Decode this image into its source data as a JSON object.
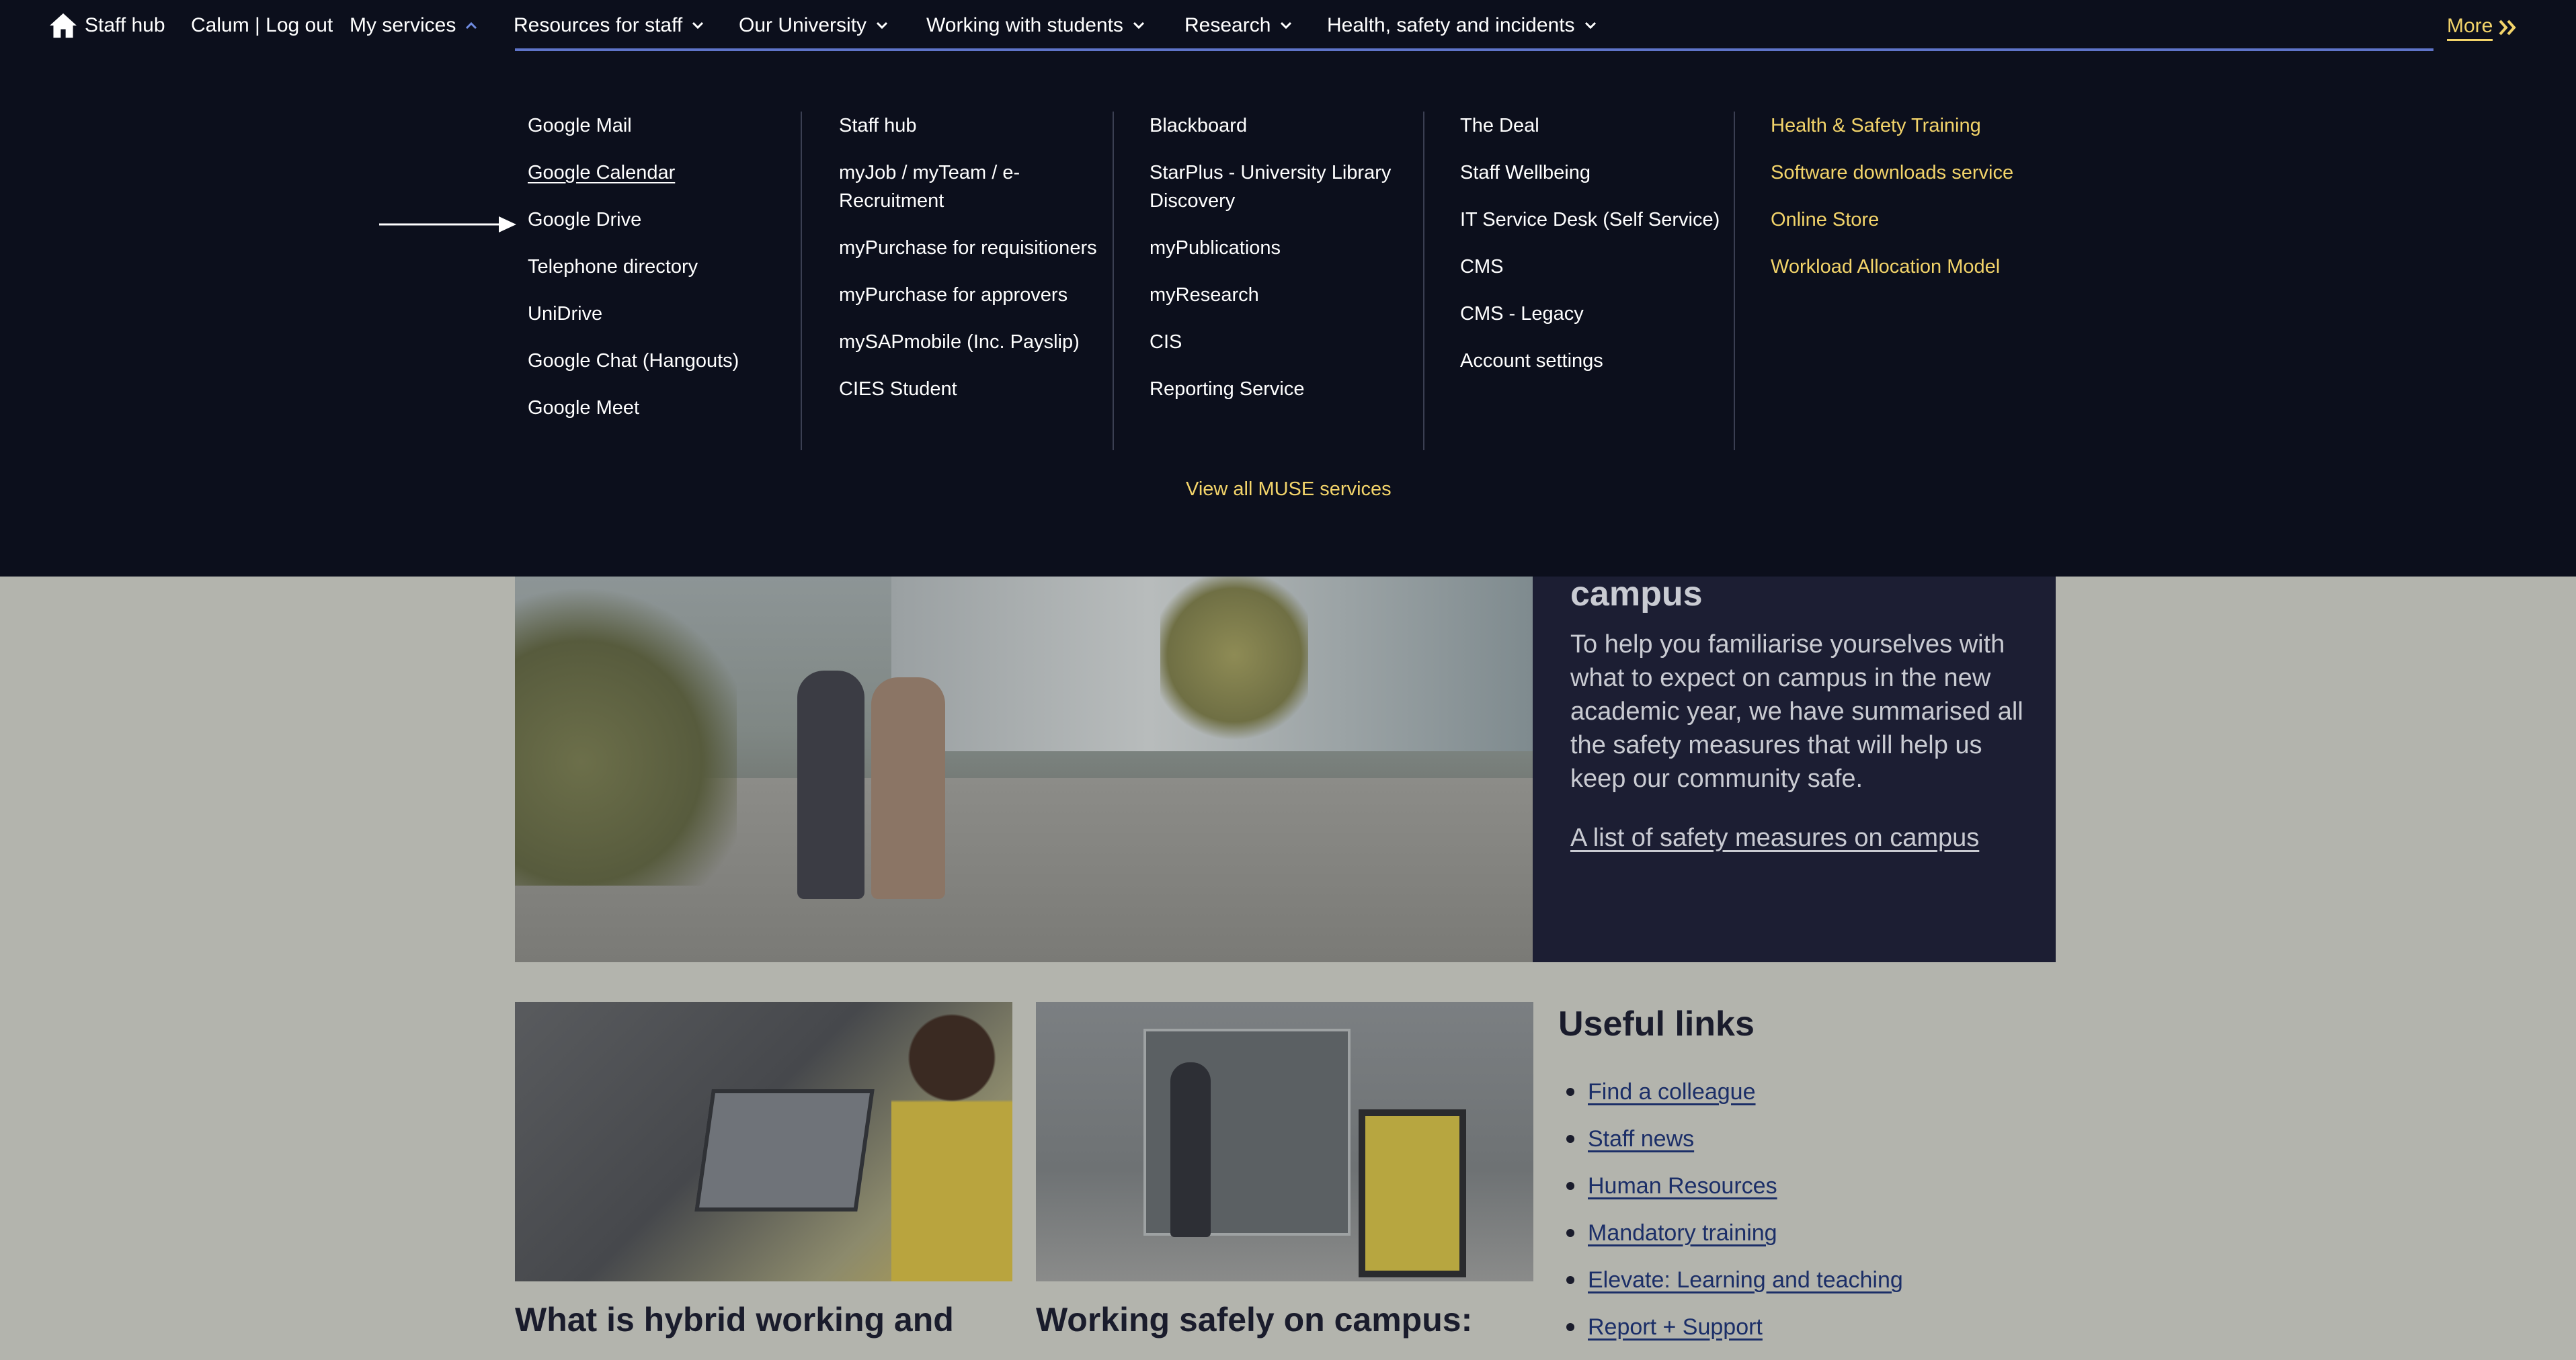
{
  "topnav": {
    "home_label": "Staff hub",
    "user": "Calum | Log out",
    "items": [
      {
        "label": "My services"
      },
      {
        "label": "Resources for staff"
      },
      {
        "label": "Our University"
      },
      {
        "label": "Working with students"
      },
      {
        "label": "Research"
      },
      {
        "label": "Health, safety and incidents"
      }
    ],
    "more_label": "More"
  },
  "menu": {
    "col1": [
      "Google Mail",
      "Google Calendar",
      "Google Drive",
      "Telephone directory",
      "UniDrive",
      "Google Chat (Hangouts)",
      "Google Meet"
    ],
    "col2": [
      "Staff hub",
      "myJob / myTeam / e-Recruitment",
      "myPurchase for requisitioners",
      "myPurchase for approvers",
      "mySAPmobile (Inc. Payslip)",
      "CIES Student"
    ],
    "col3": [
      "Blackboard",
      "StarPlus - University Library Discovery",
      "myPublications",
      "myResearch",
      "CIS",
      "Reporting Service"
    ],
    "col4": [
      "The Deal",
      "Staff Wellbeing",
      "IT Service Desk (Self Service)",
      "CMS",
      "CMS - Legacy",
      "Account settings"
    ],
    "col5": [
      "Health & Safety Training",
      "Software downloads service",
      "Online Store",
      "Workload Allocation Model"
    ],
    "view_all": "View all MUSE services"
  },
  "hero": {
    "heading": "campus",
    "paragraph": "To help you familiarise yourselves with what to expect on campus in the new academic year, we have summarised all the safety measures that will help us keep our community safe.",
    "link": "A list of safety measures on campus"
  },
  "cards": [
    {
      "title": "What is hybrid working and"
    },
    {
      "title": "Working safely on campus:"
    }
  ],
  "useful_links": {
    "heading": "Useful links",
    "items": [
      "Find a colleague",
      "Staff news",
      "Human Resources",
      "Mandatory training",
      "Elevate: Learning and teaching",
      "Report + Support"
    ]
  },
  "colors": {
    "nav_bg": "#0c0f1c",
    "accent_gold": "#f3d46a",
    "link_blue": "#1b2e67",
    "overlay_bg": "#b3b4ad"
  }
}
